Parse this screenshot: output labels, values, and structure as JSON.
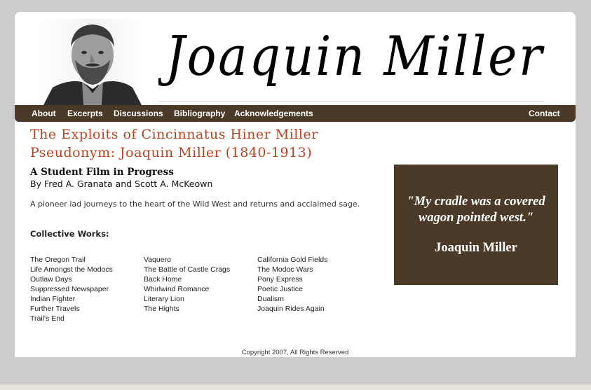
{
  "header": {
    "signature_text": "Joaquin Miller"
  },
  "nav": {
    "about": "About",
    "excerpts": "Excerpts",
    "discussions": "Discussions",
    "bibliography": "Bibliography",
    "acknowledgements": "Acknowledgements",
    "contact": "Contact"
  },
  "main": {
    "title_line1": "The Exploits of Cincinnatus Hiner Miller",
    "title_line2": "Pseudonym: Joaquin Miller (1840-1913)",
    "subtitle": "A Student Film in Progress",
    "byline": "By Fred A. Granata and Scott A. McKeown",
    "tagline": "A pioneer lad journeys to the heart of the Wild West and returns and acclaimed sage.",
    "works_heading": "Collective Works:",
    "works": {
      "col1": [
        "The Oregon Trail",
        "Life Amongst the Modocs",
        "Outlaw Days",
        "Suppressed Newspaper",
        "Indian Fighter",
        "Further Travels",
        "Trail's End"
      ],
      "col2": [
        "Vaquero",
        "The Battle of Castle Crags",
        "Back Home",
        "Whirlwind Romance",
        "Literary Lion",
        "The Hights"
      ],
      "col3": [
        "California Gold Fields",
        "The Modoc Wars",
        "Pony Express",
        "Poetic Justice",
        "Dualism",
        "Joaquin Rides Again"
      ]
    }
  },
  "quote": {
    "line1": "\"My cradle was a covered",
    "line2": "wagon pointed west.\"",
    "author": "Joaquin Miller"
  },
  "footer": {
    "copyright": "Copyright 2007, All Rights Reserved"
  },
  "colors": {
    "accent_brown": "#4b3a28",
    "title_red": "#b8431f"
  }
}
